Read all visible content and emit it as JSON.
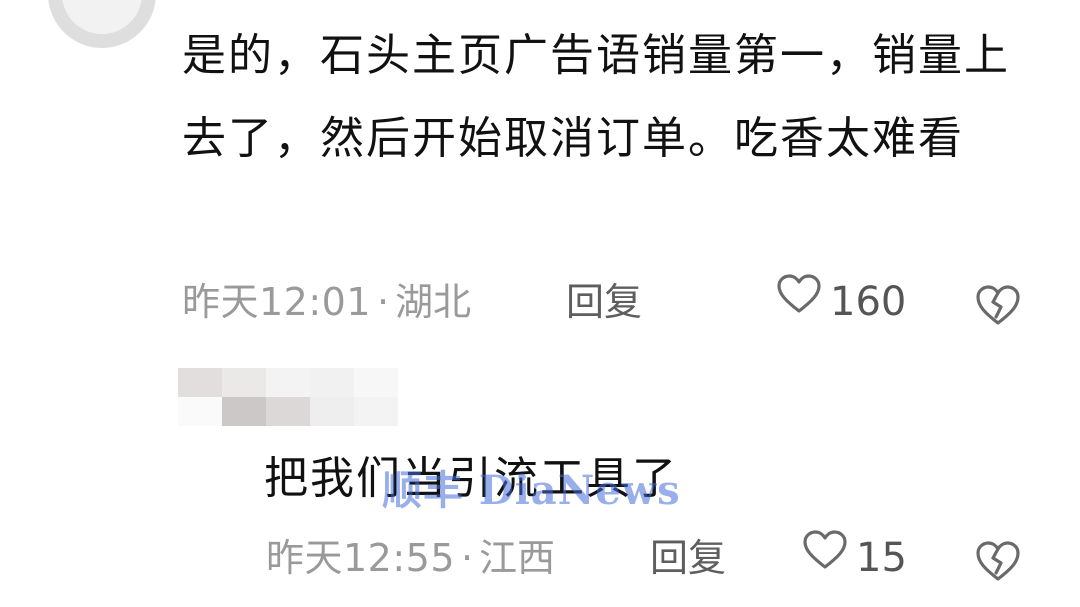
{
  "comment": {
    "text": "是的，石头主页广告语销量第一，销量上去了，然后开始取消订单。吃香太难看",
    "time": "昨天12:01",
    "dot": "·",
    "location": "湖北",
    "reply_label": "回复",
    "like_count": "160"
  },
  "reply": {
    "text": "把我们当引流工具了",
    "time": "昨天12:55",
    "dot": "·",
    "location": "江西",
    "reply_label": "回复",
    "like_count": "15"
  },
  "watermark": "顺丰 DiaNews",
  "icons": {
    "like": "heart-outline-icon",
    "dislike": "broken-heart-icon"
  },
  "colors": {
    "text": "#111111",
    "meta": "#9a9a9a",
    "reply_action": "#5e5e5e",
    "icon": "#6a6a6a",
    "watermark": "#466edc"
  }
}
